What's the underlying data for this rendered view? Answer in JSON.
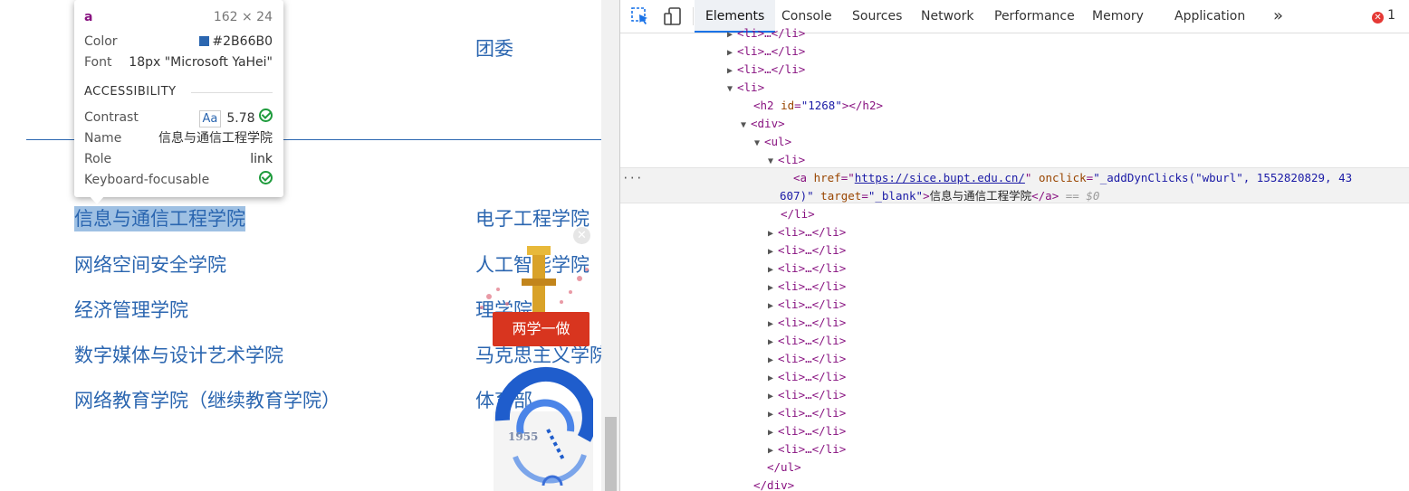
{
  "page": {
    "top_link": "团委",
    "colleges_left": [
      "信息与通信工程学院",
      "网络空间安全学院",
      "经济管理学院",
      "数字媒体与设计艺术学院",
      "网络教育学院（继续教育学院）"
    ],
    "colleges_right": [
      "电子工程学院",
      "人工智能学院",
      "理学院",
      "马克思主义学院",
      "体育部"
    ],
    "selected_index": 0,
    "badge_text": "两学一做",
    "logo_year": "1955"
  },
  "tooltip": {
    "tag": "a",
    "size": "162 × 24",
    "color_label": "Color",
    "color_value": "#2B66B0",
    "font_label": "Font",
    "font_value": "18px \"Microsoft YaHei\"",
    "section": "ACCESSIBILITY",
    "contrast_label": "Contrast",
    "contrast_aa": "Aa",
    "contrast_value": "5.78",
    "name_label": "Name",
    "name_value": "信息与通信工程学院",
    "role_label": "Role",
    "role_value": "link",
    "kbd_label": "Keyboard-focusable"
  },
  "devtools": {
    "tabs": [
      "Elements",
      "Console",
      "Sources",
      "Network",
      "Performance",
      "Memory",
      "Application"
    ],
    "active_tab": "Elements",
    "more": "»",
    "error_count": "1",
    "error_glyph": "✕",
    "tree": {
      "li_collapsed": "<li>…</li>",
      "li_open": "<li>",
      "h2_tag_open": "<h2 ",
      "h2_attr": "id",
      "h2_val": "\"1268\"",
      "h2_close": "></h2>",
      "div_open": "<div>",
      "ul_open": "<ul>",
      "a_open": "<a ",
      "href_attr": "href",
      "href_val": "https://sice.bupt.edu.cn/",
      "onclick_attr": " onclick",
      "onclick_val_1": "\"_addDynClicks(\"wburl\", 1552820829, 43",
      "onclick_val_2": "607)\"",
      "target_attr": " target",
      "target_val": "\"_blank\"",
      "a_text": "信息与通信工程学院",
      "a_close": "</a>",
      "dollar0": "== $0",
      "li_close": "</li>",
      "ul_close": "</ul>",
      "div_close": "</div>",
      "dots": "···"
    }
  }
}
